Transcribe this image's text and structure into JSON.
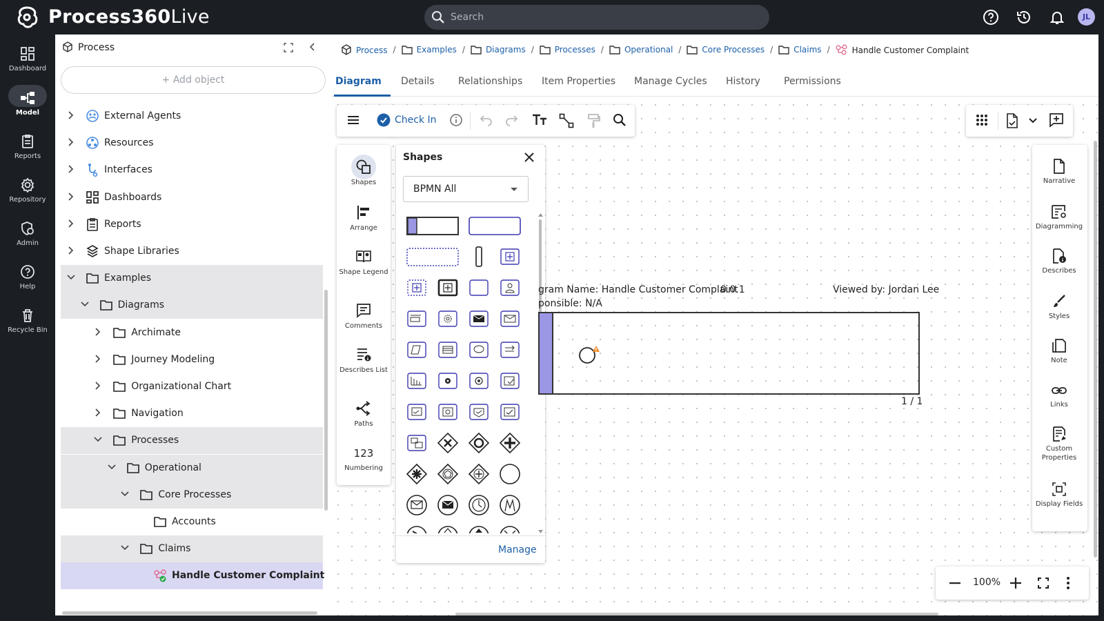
{
  "app": {
    "title_bold": "Process360",
    "title_light": "Live",
    "avatar_initials": "JL"
  },
  "search": {
    "placeholder": "Search"
  },
  "nav": [
    {
      "label": "Dashboard",
      "icon": "dashboard-icon"
    },
    {
      "label": "Model",
      "icon": "model-icon",
      "active": true
    },
    {
      "label": "Reports",
      "icon": "reports-icon"
    },
    {
      "label": "Repository",
      "icon": "repository-icon"
    },
    {
      "label": "Admin",
      "icon": "admin-icon"
    },
    {
      "label": "Help",
      "icon": "help-icon"
    },
    {
      "label": "Recycle Bin",
      "icon": "recycle-bin-icon"
    }
  ],
  "tree": {
    "title": "Process",
    "add_object": "+ Add object",
    "items": [
      {
        "label": "External Agents",
        "icon": "external-agents-icon"
      },
      {
        "label": "Resources",
        "icon": "resources-icon"
      },
      {
        "label": "Interfaces",
        "icon": "interfaces-icon"
      },
      {
        "label": "Dashboards",
        "icon": "dashboards-icon"
      },
      {
        "label": "Reports",
        "icon": "reports-icon"
      },
      {
        "label": "Shape Libraries",
        "icon": "shape-libraries-icon"
      },
      {
        "label": "Examples",
        "icon": "folder-icon"
      },
      {
        "label": "Diagrams",
        "icon": "folder-icon"
      },
      {
        "label": "Archimate",
        "icon": "folder-icon"
      },
      {
        "label": "Journey Modeling",
        "icon": "folder-icon"
      },
      {
        "label": "Organizational Chart",
        "icon": "folder-icon"
      },
      {
        "label": "Navigation",
        "icon": "folder-icon"
      },
      {
        "label": "Processes",
        "icon": "folder-icon"
      },
      {
        "label": "Operational",
        "icon": "folder-icon"
      },
      {
        "label": "Core Processes",
        "icon": "folder-icon"
      },
      {
        "label": "Accounts",
        "icon": "folder-icon"
      },
      {
        "label": "Claims",
        "icon": "folder-icon"
      },
      {
        "label": "Handle Customer Complaint",
        "icon": "process-diagram-icon"
      }
    ]
  },
  "breadcrumb": [
    "Process",
    "Examples",
    "Diagrams",
    "Processes",
    "Operational",
    "Core Processes",
    "Claims",
    "Handle Customer Complaint"
  ],
  "tabs": [
    "Diagram",
    "Details",
    "Relationships",
    "Item Properties",
    "Manage Cycles",
    "History",
    "Permissions"
  ],
  "toolbar": {
    "check_in": "Check In"
  },
  "siderail": [
    {
      "label": "Shapes",
      "icon": "shapes-icon"
    },
    {
      "label": "Arrange",
      "icon": "arrange-icon"
    },
    {
      "label": "Shape Legend",
      "icon": "shape-legend-icon"
    },
    {
      "label": "Comments",
      "icon": "comments-icon"
    },
    {
      "label": "Describes List",
      "icon": "describes-list-icon"
    },
    {
      "label": "Paths",
      "icon": "paths-icon"
    },
    {
      "label": "Numbering",
      "icon": "numbering-icon"
    }
  ],
  "shapes_panel": {
    "title": "Shapes",
    "library": "BPMN All",
    "manage": "Manage"
  },
  "diagram": {
    "name_line": "gram Name: Handle Customer Complaint",
    "responsible_line": "ponsible: N/A",
    "version": "0.0.1",
    "viewed_by": "Viewed by: Jordan Lee",
    "page": "1 / 1"
  },
  "rightrail": [
    {
      "label": "Narrative",
      "icon": "narrative-icon"
    },
    {
      "label": "Diagramming",
      "icon": "diagramming-icon"
    },
    {
      "label": "Describes",
      "icon": "describes-icon"
    },
    {
      "label": "Styles",
      "icon": "styles-icon"
    },
    {
      "label": "Note",
      "icon": "note-icon"
    },
    {
      "label": "Links",
      "icon": "links-icon"
    },
    {
      "label": "Custom Properties",
      "icon": "custom-properties-icon"
    },
    {
      "label": "Display Fields",
      "icon": "display-fields-icon"
    }
  ],
  "zoom": {
    "value": "100%"
  },
  "colors": {
    "accent": "#1c5fa8",
    "pool_header": "#9b97e4",
    "selected_row": "#d9d8f3",
    "warning": "#f08a24"
  }
}
